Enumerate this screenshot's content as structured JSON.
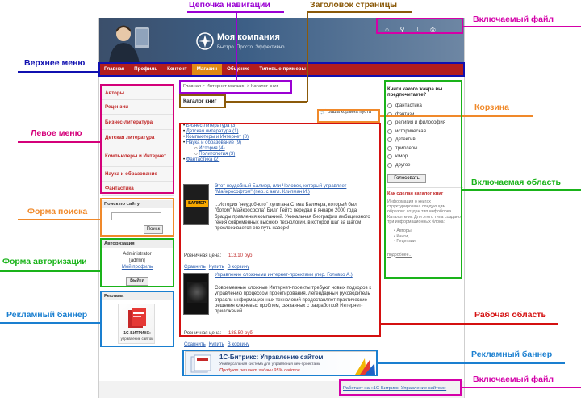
{
  "site": {
    "company_name": "Моя компания",
    "slogan": "Быстро. Просто. Эффективно",
    "header_icons": [
      "home-icon",
      "search-icon",
      "sitemap-icon",
      "print-icon"
    ],
    "top_menu": [
      {
        "label": "Главная",
        "active": false
      },
      {
        "label": "Профиль",
        "active": false
      },
      {
        "label": "Контент",
        "active": false
      },
      {
        "label": "Магазин",
        "active": true
      },
      {
        "label": "Общение",
        "active": false
      },
      {
        "label": "Типовые примеры",
        "active": false
      }
    ],
    "left_menu": [
      "Авторы",
      "Рецензии",
      "Бизнес-литература",
      "Детская литература",
      "Компьютеры и Интернет",
      "Наука и образование",
      "Фантастика"
    ],
    "search": {
      "title": "Поиск по сайту",
      "button": "Поиск"
    },
    "auth": {
      "title": "Авторизация",
      "user": "Administrator",
      "login": "[admin]",
      "profile_link": "Мой профиль",
      "logout_button": "Выйти"
    },
    "ad": {
      "title": "Реклама",
      "caption_line1": "1С-БИТРИКС:",
      "caption_line2": "управление сайтом"
    },
    "breadcrumb": "Главная > Интернет-магазин > Каталог книг",
    "page_title": "Каталог книг",
    "cart_text": "Ваша корзина пуста",
    "categories": [
      {
        "label": "Бизнес-литература (3)",
        "level": 0
      },
      {
        "label": "Детская литература (1)",
        "level": 0
      },
      {
        "label": "Компьютеры и Интернет (8)",
        "level": 0
      },
      {
        "label": "Наука и образование (9)",
        "level": 0
      },
      {
        "label": "История (4)",
        "level": 1
      },
      {
        "label": "Политология (3)",
        "level": 1
      },
      {
        "label": "Фантастика (2)",
        "level": 0
      }
    ],
    "books": [
      {
        "title": "Этот неудобный Балмер, или Человек, который управляет \"Майкрософтом\" (пер. с англ. Клипман И.)",
        "text": "...История \"неудобного\" хулигана Стива Балмера, который был \"ботом\" Майкрософта\" Билл Гейтс передал в январе 2000 года бразды правления компанией. Уникальная биография амбициозного гения современных высоких технологий, в которой шаг за шагом прослеживается его путь наверх!",
        "price_label": "Розничная цена:",
        "price": "113.10 руб",
        "cover": "БАЛМЕР",
        "actions": [
          "Сравнить",
          "Купить",
          "В корзину"
        ]
      },
      {
        "title": "Управление сложными интернет-проектами (пер. Головко А.)",
        "text": "Современные сложные Интернет-проекты требуют новых подходов к управлению процессом проектирования. Легендарный руководитель отрасли информационных технологий предоставляет практические решения ключевых проблем, связанных с разработкой Интернет-приложений...",
        "price_label": "Розничная цена:",
        "price": "188.50 руб",
        "actions": [
          "Сравнить",
          "Купить",
          "В корзину"
        ]
      }
    ],
    "poll": {
      "question": "Книги какого жанра вы предпочитаете?",
      "options": [
        "фантастика",
        "фэнтази",
        "религия и философия",
        "историческая",
        "детектив",
        "триллеры",
        "юмор",
        "другое"
      ],
      "button": "Голосовать"
    },
    "include_area": {
      "title": "Как сделан каталог книг",
      "text": "Информация о книгах структурирована следующим образом: создан тип инфоблока Каталог книг. Для этого типа создано три информационных блока:",
      "list": [
        "Авторы,",
        "Книги,",
        "Рецензии."
      ],
      "more": "подробнее..."
    },
    "banner_bottom": {
      "title": "1С-Битрикс: Управление сайтом",
      "subtitle": "Универсальная система для управления веб-проектами",
      "tagline": "Продукт решает задачи 95% сайтов"
    },
    "footer_link": "Работает на «1С-Битрикс: Управление сайтом»"
  },
  "annotations": [
    {
      "label": "Цепочка навигации",
      "color": "#9b00d3"
    },
    {
      "label": "Заголовок страницы",
      "color": "#8b5a0a"
    },
    {
      "label": "Включаемый файл",
      "color": "#d400a8"
    },
    {
      "label": "Верхнее меню",
      "color": "#1010b0"
    },
    {
      "label": "Левое меню",
      "color": "#d4007a"
    },
    {
      "label": "Корзина",
      "color": "#f0892a"
    },
    {
      "label": "Включаемая область",
      "color": "#1ab31a"
    },
    {
      "label": "Форма поиска",
      "color": "#f0892a"
    },
    {
      "label": "Форма авторизации",
      "color": "#1ab31a"
    },
    {
      "label": "Рекламный баннер",
      "color": "#1a7fd0"
    },
    {
      "label": "Рабочая область",
      "color": "#d41010"
    },
    {
      "label": "Рекламный баннер",
      "color": "#1a7fd0"
    },
    {
      "label": "Включаемый файл",
      "color": "#d400a8"
    }
  ]
}
